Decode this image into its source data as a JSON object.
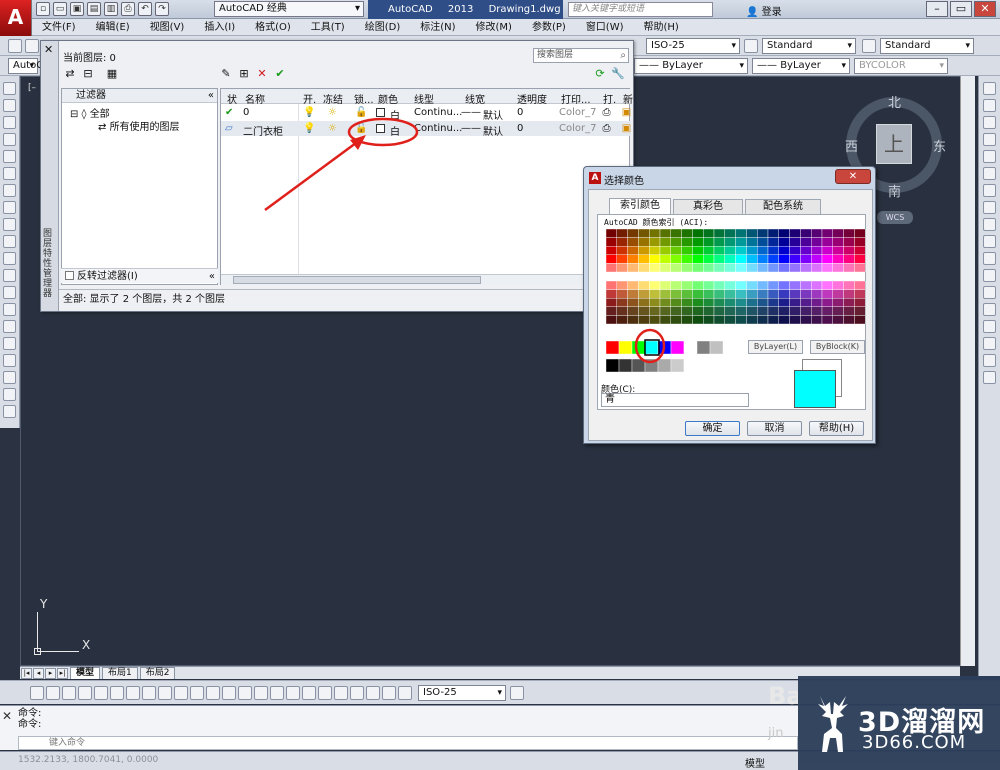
{
  "titlebar": {
    "app_logo": "A",
    "workspace": "AutoCAD 经典",
    "app_version": "AutoCAD 2013",
    "document": "Drawing1.dwg",
    "search_placeholder": "键入关键字或短语",
    "login": "登录"
  },
  "menu": [
    "文件(F)",
    "编辑(E)",
    "视图(V)",
    "插入(I)",
    "格式(O)",
    "工具(T)",
    "绘图(D)",
    "标注(N)",
    "修改(M)",
    "参数(P)",
    "窗口(W)",
    "帮助(H)"
  ],
  "toolbar": {
    "dimstyle": "ISO-25",
    "textstyle": "Standard",
    "tablestyle": "Standard",
    "linetype": "ByLayer",
    "lineweight": "ByLayer",
    "plotstyle": "BYCOLOR",
    "left_combo": "AutoC",
    "dim_toolbar_style": "ISO-25"
  },
  "viewport": {
    "label": "[–",
    "viewcube_top": "上",
    "north": "北",
    "south": "南",
    "east": "东",
    "west": "西",
    "wcs": "WCS",
    "ucs_x": "X",
    "ucs_y": "Y"
  },
  "layer_palette": {
    "close_glyph": "✕",
    "vertical_title": "图层特性管理器",
    "current_layer": "当前图层: 0",
    "search_placeholder": "搜索图层",
    "filter_header": "过滤器",
    "tree_all": "全部",
    "tree_used": "所有使用的图层",
    "invert_filter": "反转过滤器(I)",
    "columns": [
      "状",
      "名称",
      "开.",
      "冻结",
      "锁...",
      "颜色",
      "线型",
      "线宽",
      "透明度",
      "打印...",
      "打.",
      "新"
    ],
    "layers": [
      {
        "status": "✔",
        "name": "0",
        "color": "白",
        "linetype": "Continu...",
        "lineweight": "默认",
        "transparency": "0",
        "plotstyle": "Color_7"
      },
      {
        "status": "▱",
        "name": "二门衣柜",
        "color": "白",
        "linetype": "Continu...",
        "lineweight": "默认",
        "transparency": "0",
        "plotstyle": "Color_7"
      }
    ],
    "status": "全部: 显示了 2 个图层，共 2 个图层"
  },
  "color_dialog": {
    "title": "选择颜色",
    "tabs": [
      "索引颜色",
      "真彩色",
      "配色系统"
    ],
    "aci_label": "AutoCAD 颜色索引 (ACI):",
    "bylayer": "ByLayer(L)",
    "byblock": "ByBlock(K)",
    "color_label": "颜色(C):",
    "color_value": "青",
    "ok": "确定",
    "cancel": "取消",
    "help": "帮助(H)",
    "selected_color": "#00ffff"
  },
  "layout_tabs": [
    "模型",
    "布局1",
    "布局2"
  ],
  "command": {
    "history": [
      "命令:",
      "命令:"
    ],
    "placeholder": "键入命令"
  },
  "status": {
    "coords": "1532.2133, 1800.7041, 0.0000",
    "space": "模型"
  },
  "watermark": {
    "cn": "3D溜溜网",
    "en": "3D66.COM",
    "bai": "Ba",
    "jing": "jin"
  },
  "colors": {
    "accent_red": "#e0201a",
    "cyan": "#00ffff",
    "canvas_bg": "#293140"
  }
}
